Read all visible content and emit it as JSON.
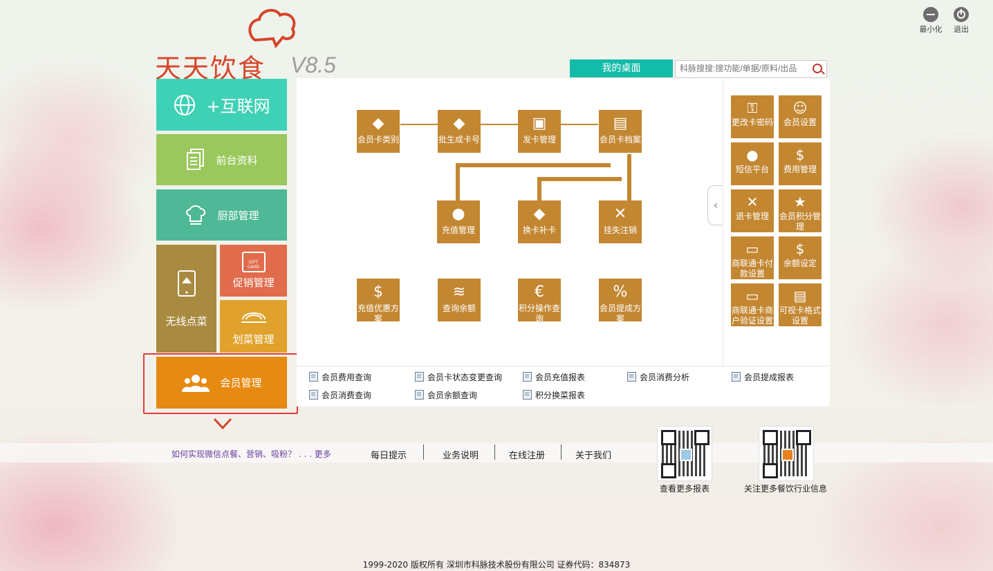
{
  "window": {
    "minimize_label": "最小化",
    "exit_label": "退出"
  },
  "logo": {
    "name": "天天饮食",
    "version": "V8.5"
  },
  "desktop_tab": "我的桌面",
  "search": {
    "placeholder": "科脉搜搜:搜功能/单据/原料/出品"
  },
  "nav": {
    "internet": "+互联网",
    "front_desk": "前台资料",
    "kitchen": "厨部管理",
    "wireless": "无线点菜",
    "promotion": "促销管理",
    "dish_mark": "划菜管理",
    "member": "会员管理",
    "gift_card_text": "GIFT CARD"
  },
  "flow": {
    "card_type": "会员卡类别",
    "batch_gen": "批生成卡号",
    "issue": "发卡管理",
    "card_archive": "会员卡档案",
    "recharge": "充值管理",
    "replace": "换卡补卡",
    "lost": "挂失注销",
    "recharge_promo": "充值优惠方案",
    "balance_query": "查询余额",
    "points_query": "积分操作查询",
    "commission": "会员提成方案"
  },
  "side": {
    "change_pwd": "更改卡密码",
    "member_settings": "会员设置",
    "sms": "短信平台",
    "fee_mgmt": "费用管理",
    "refund": "退卡管理",
    "points_mgmt": "会员积分管理",
    "slt_pay": "商联通卡付款设置",
    "balance_set": "余额设定",
    "slt_verify": "商联通卡商户验证设置",
    "visual_card": "可视卡格式设置"
  },
  "reports": [
    "会员费用查询",
    "会员卡状态变更查询",
    "会员充值报表",
    "会员消费分析",
    "会员提成报表",
    "会员消费查询",
    "会员余额查询",
    "积分换菜报表"
  ],
  "bottom": {
    "promo": "如何实现微信点餐、营销、吸粉？ . . . 更多",
    "daily_tip": "每日提示",
    "business": "业务说明",
    "register": "在线注册",
    "about": "关于我们",
    "qr1_label": "查看更多报表",
    "qr2_label": "关注更多餐饮行业信息"
  },
  "copyright": "1999-2020  版权所有  深圳市科脉技术股份有限公司  证券代码：834873",
  "colors": {
    "teal": "#3fd1b5",
    "green": "#9ac85c",
    "kitchen": "#4fb896",
    "olive": "#a88a40",
    "promo": "#e06c4c",
    "gold": "#e0a22c",
    "member": "#e68a12",
    "brown": "#c38732"
  }
}
